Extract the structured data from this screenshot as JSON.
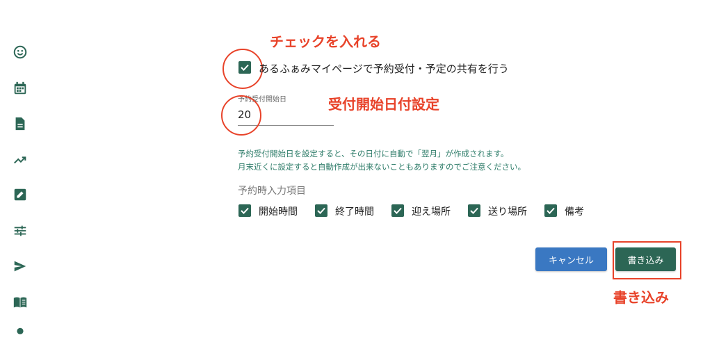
{
  "sidebar": {
    "icons": [
      "smiley-icon",
      "calendar-icon",
      "document-icon",
      "trending-up-icon",
      "edit-icon",
      "sliders-icon",
      "send-icon",
      "book-icon",
      "person-icon"
    ]
  },
  "annotations": {
    "check_label": "チェックを入れる",
    "start_date_label": "受付開始日付設定",
    "write_label": "書き込み",
    "color": "#e8432a"
  },
  "form": {
    "share_checkbox": {
      "label": "あるふぁみマイページで予約受付・予定の共有を行う",
      "checked": true
    },
    "start_day": {
      "label": "予約受付開始日",
      "value": "20"
    },
    "note_line1": "予約受付開始日を設定すると、その日付に自動で「翌月」が作成されます。",
    "note_line2": "月末近くに設定すると自動作成が出来ないこともありますのでご注意ください。",
    "input_items_title": "予約時入力項目",
    "input_items": [
      {
        "label": "開始時間",
        "checked": true
      },
      {
        "label": "終了時間",
        "checked": true
      },
      {
        "label": "迎え場所",
        "checked": true
      },
      {
        "label": "送り場所",
        "checked": true
      },
      {
        "label": "備考",
        "checked": true
      }
    ]
  },
  "buttons": {
    "cancel": "キャンセル",
    "write": "書き込み",
    "cancel_color": "#3a78c2",
    "write_color": "#2c6655"
  },
  "colors": {
    "accent": "#2c6655",
    "note": "#2f7d6a"
  }
}
